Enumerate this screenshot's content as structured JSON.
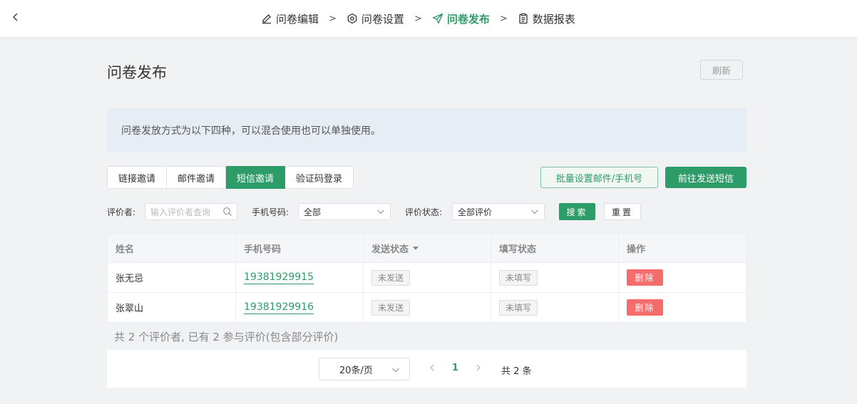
{
  "nav": {
    "steps": [
      {
        "label": "问卷编辑",
        "icon": "edit-icon"
      },
      {
        "label": "问卷设置",
        "icon": "settings-icon"
      },
      {
        "label": "问卷发布",
        "icon": "send-icon",
        "active": true
      },
      {
        "label": "数据报表",
        "icon": "clipboard-icon"
      }
    ],
    "separator": ">"
  },
  "header": {
    "title": "问卷发布",
    "refresh_label": "刷新"
  },
  "notice": "问卷发放方式为以下四种，可以混合使用也可以单独使用。",
  "tabs": [
    {
      "label": "链接邀请",
      "active": false
    },
    {
      "label": "邮件邀请",
      "active": false
    },
    {
      "label": "短信邀请",
      "active": true
    },
    {
      "label": "验证码登录",
      "active": false
    }
  ],
  "actions": {
    "batch_label": "批量设置邮件/手机号",
    "send_label": "前往发送短信"
  },
  "filters": {
    "evaluator_label": "评价者:",
    "evaluator_placeholder": "输入评价者查询",
    "phone_label": "手机号码:",
    "phone_value": "全部",
    "status_label": "评价状态:",
    "status_value": "全部评价",
    "search_label": "搜索",
    "reset_label": "重置"
  },
  "table": {
    "columns": [
      "姓名",
      "手机号码",
      "发送状态",
      "填写状态",
      "操作"
    ],
    "rows": [
      {
        "name": "张无忌",
        "phone": "19381929915",
        "send_status": "未发送",
        "fill_status": "未填写",
        "action": "删除"
      },
      {
        "name": "张翠山",
        "phone": "19381929916",
        "send_status": "未发送",
        "fill_status": "未填写",
        "action": "删除"
      }
    ]
  },
  "summary": "共 2 个评价者, 已有 2 参与评价(包含部分评价)",
  "pagination": {
    "page_size": "20条/页",
    "current_page": "1",
    "total": "共 2 条"
  },
  "colors": {
    "accent": "#2d9c68",
    "danger": "#f56c6c"
  }
}
